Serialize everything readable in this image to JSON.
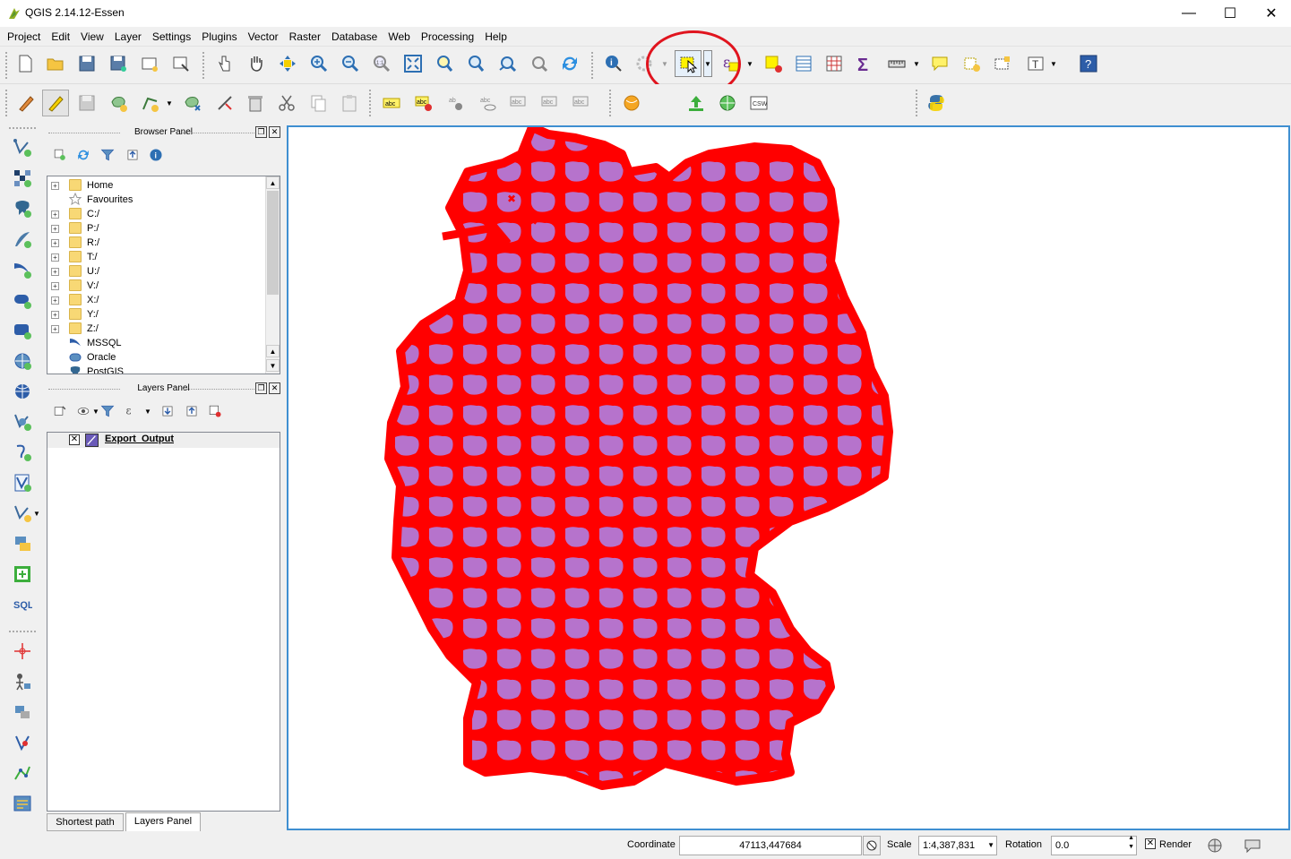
{
  "window": {
    "title": "QGIS 2.14.12-Essen"
  },
  "menu": [
    "Project",
    "Edit",
    "View",
    "Layer",
    "Settings",
    "Plugins",
    "Vector",
    "Raster",
    "Database",
    "Web",
    "Processing",
    "Help"
  ],
  "browser_panel": {
    "title": "Browser Panel",
    "items": [
      {
        "label": "Home",
        "icon": "folder-icon",
        "expandable": true
      },
      {
        "label": "Favourites",
        "icon": "star-icon",
        "expandable": false
      },
      {
        "label": "C:/",
        "icon": "folder-icon",
        "expandable": true
      },
      {
        "label": "P:/",
        "icon": "folder-icon",
        "expandable": true
      },
      {
        "label": "R:/",
        "icon": "folder-icon",
        "expandable": true
      },
      {
        "label": "T:/",
        "icon": "folder-icon",
        "expandable": true
      },
      {
        "label": "U:/",
        "icon": "folder-icon",
        "expandable": true
      },
      {
        "label": "V:/",
        "icon": "folder-icon",
        "expandable": true
      },
      {
        "label": "X:/",
        "icon": "folder-icon",
        "expandable": true
      },
      {
        "label": "Y:/",
        "icon": "folder-icon",
        "expandable": true
      },
      {
        "label": "Z:/",
        "icon": "folder-icon",
        "expandable": true
      },
      {
        "label": "MSSQL",
        "icon": "mssql-icon",
        "expandable": false
      },
      {
        "label": "Oracle",
        "icon": "oracle-icon",
        "expandable": false
      },
      {
        "label": "PostGIS",
        "icon": "postgis-icon",
        "expandable": false
      }
    ]
  },
  "layers_panel": {
    "title": "Layers Panel",
    "layers": [
      {
        "name": "Export_Output",
        "visible": false
      }
    ]
  },
  "tabs": {
    "shortest_path": "Shortest path",
    "layers_panel": "Layers Panel"
  },
  "status": {
    "coordinate_label": "Coordinate",
    "coordinate_value": "47113,447684",
    "scale_label": "Scale",
    "scale_value": "1:4,387,831",
    "rotation_label": "Rotation",
    "rotation_value": "0.0",
    "render_label": "Render"
  },
  "map": {
    "fill": "#b673cc",
    "stroke": "#ff0000"
  },
  "toolbar_2": {
    "csw_label": "CSW"
  },
  "left_toolbar": {
    "sql_label": "SQL"
  }
}
